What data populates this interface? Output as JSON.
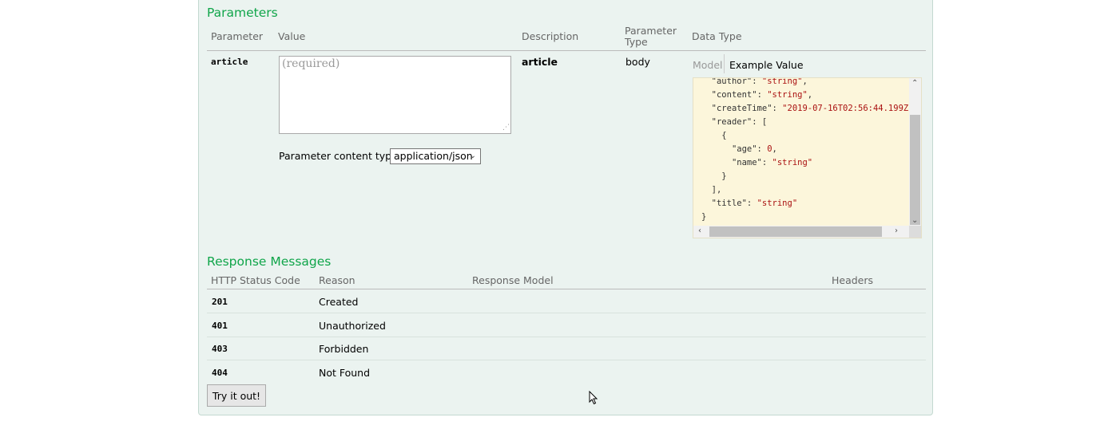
{
  "parameters": {
    "title": "Parameters",
    "headers": {
      "parameter": "Parameter",
      "value": "Value",
      "description": "Description",
      "parameter_type_line1": "Parameter",
      "parameter_type_line2": "Type",
      "data_type": "Data Type"
    },
    "row": {
      "name": "article",
      "placeholder": "(required)",
      "description": "article",
      "parameter_type": "body",
      "content_type_label": "Parameter content type:",
      "content_type_value": "application/json"
    },
    "data_type_tabs": {
      "model": "Model",
      "example_value": "Example Value"
    },
    "example_code_lines": [
      "  \"author\": \"string\",",
      "  \"content\": \"string\",",
      "  \"createTime\": \"2019-07-16T02:56:44.199Z",
      "  \"reader\": [",
      "    {",
      "      \"age\": 0,",
      "      \"name\": \"string\"",
      "    }",
      "  ],",
      "  \"title\": \"string\"",
      "}"
    ]
  },
  "responses": {
    "title": "Response Messages",
    "headers": {
      "status": "HTTP Status Code",
      "reason": "Reason",
      "model": "Response Model",
      "headers": "Headers"
    },
    "rows": [
      {
        "code": "201",
        "reason": "Created"
      },
      {
        "code": "401",
        "reason": "Unauthorized"
      },
      {
        "code": "403",
        "reason": "Forbidden"
      },
      {
        "code": "404",
        "reason": "Not Found"
      }
    ]
  },
  "try_button": "Try it out!",
  "colors": {
    "panel_bg": "#ebf3f0",
    "section_title": "#10a54a",
    "code_bg": "#fcf6db"
  }
}
